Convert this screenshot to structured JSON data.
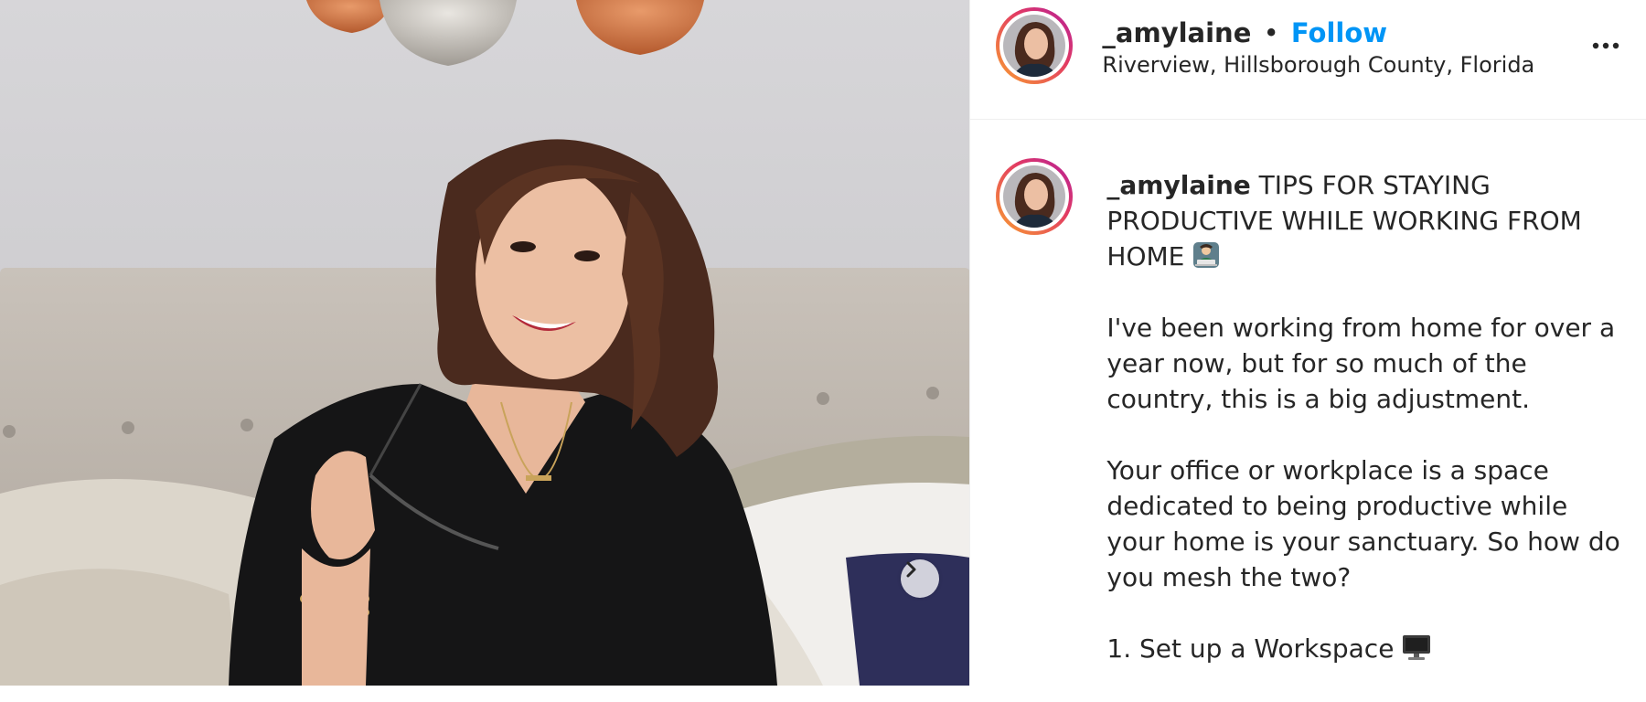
{
  "post": {
    "username": "_amylaine",
    "separator": "•",
    "follow_label": "Follow",
    "location": "Riverview, Hillsborough County, Florida",
    "more_icon": "more-horizontal-icon",
    "next_icon": "chevron-right-icon"
  },
  "caption": {
    "username": "_amylaine",
    "title": "TIPS FOR STAYING PRODUCTIVE WHILE WORKING FROM HOME",
    "title_emoji": "person-at-laptop-emoji",
    "paragraph_1": "I've been working from home for over a year now, but for so much of the country, this is a big adjustment.",
    "paragraph_2": "Your office or workplace is a space dedicated to being productive while your home is your sanctuary. So how do you mesh the two?",
    "item_1": "1. Set up a Workspace",
    "item_1_emoji": "desktop-computer-emoji"
  },
  "colors": {
    "follow": "#0095f6",
    "story_ring_start": "#f9a030",
    "story_ring_end": "#b31f9c",
    "text": "#262626"
  }
}
